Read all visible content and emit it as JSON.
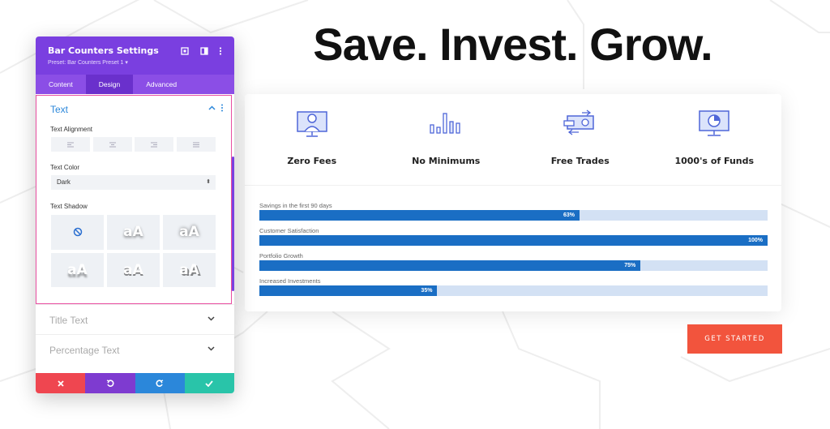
{
  "headline": "Save. Invest. Grow.",
  "features": [
    {
      "label": "Zero Fees",
      "icon": "monitor-user-icon"
    },
    {
      "label": "No Minimums",
      "icon": "bar-chart-icon"
    },
    {
      "label": "Free Trades",
      "icon": "money-exchange-icon"
    },
    {
      "label": "1000's of Funds",
      "icon": "pie-chart-monitor-icon"
    }
  ],
  "bars": [
    {
      "title": "Savings in the first 90 days",
      "percent_label": "63%",
      "value": 63
    },
    {
      "title": "Customer Satisfaction",
      "percent_label": "100%",
      "value": 100
    },
    {
      "title": "Portfolio Growth",
      "percent_label": "75%",
      "value": 75
    },
    {
      "title": "Increased Investments",
      "percent_label": "35%",
      "value": 35
    }
  ],
  "cta_label": "GET STARTED",
  "panel": {
    "title": "Bar Counters Settings",
    "preset": "Preset: Bar Counters Preset 1 ▾",
    "tabs": [
      "Content",
      "Design",
      "Advanced"
    ],
    "active_tab": "Design",
    "section_text": {
      "title": "Text",
      "alignment_label": "Text Alignment",
      "color_label": "Text Color",
      "color_value": "Dark",
      "shadow_label": "Text Shadow",
      "shadow_sample": "aA"
    },
    "collapsed_sections": [
      "Title Text",
      "Percentage Text"
    ]
  },
  "colors": {
    "panel_purple": "#7a3fe0",
    "bar_fill": "#1a6ec4",
    "bar_track": "#d3e1f4",
    "cta": "#f2543d",
    "section_border": "#e94ea1",
    "footer_cancel": "#ef4650",
    "footer_undo": "#7e3bd0",
    "footer_redo": "#2b87da",
    "footer_save": "#29c4a9"
  }
}
